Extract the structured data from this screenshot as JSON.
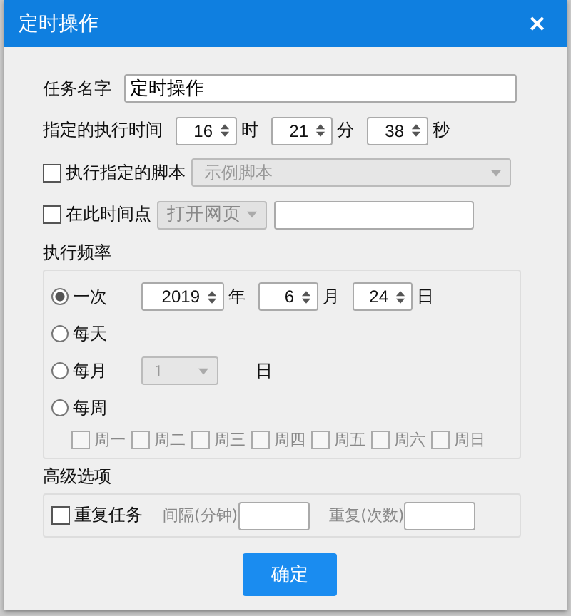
{
  "window": {
    "title": "定时操作",
    "close": "✕"
  },
  "task_name": {
    "label": "任务名字",
    "value": "定时操作"
  },
  "exec_time": {
    "label": "指定的执行时间",
    "fields": [
      {
        "value": "16",
        "unit": "时"
      },
      {
        "value": "21",
        "unit": "分"
      },
      {
        "value": "38",
        "unit": "秒"
      }
    ]
  },
  "script": {
    "label": "执行指定的脚本",
    "checked": false,
    "dropdown": {
      "value": "示例脚本",
      "disabled": true
    }
  },
  "time_point": {
    "label": "在此时间点",
    "checked": false,
    "action": {
      "label": "打开网页",
      "disabled": true
    }
  },
  "frequency": {
    "label": "执行频率",
    "options": [
      {
        "label": "一次",
        "selected": true
      },
      {
        "label": "每天",
        "selected": false
      },
      {
        "label": "每月",
        "selected": false
      },
      {
        "label": "每周",
        "selected": false
      }
    ],
    "date": [
      {
        "value": "2019",
        "unit": "年"
      },
      {
        "value": "6",
        "unit": "月"
      },
      {
        "value": "24",
        "unit": "日"
      }
    ],
    "month_day": {
      "value": "1",
      "disabled": true,
      "unit": "日"
    },
    "weekdays": [
      {
        "label": "周一",
        "checked": false,
        "disabled": true
      },
      {
        "label": "周二",
        "checked": false,
        "disabled": true
      },
      {
        "label": "周三",
        "checked": false,
        "disabled": true
      },
      {
        "label": "周四",
        "checked": false,
        "disabled": true
      },
      {
        "label": "周五",
        "checked": false,
        "disabled": true
      },
      {
        "label": "周六",
        "checked": false,
        "disabled": true
      },
      {
        "label": "周日",
        "checked": false,
        "disabled": true
      }
    ]
  },
  "advanced": {
    "label": "高级选项",
    "repeat": {
      "label": "重复任务",
      "checked": false
    },
    "interval": {
      "label": "间隔(分钟)",
      "disabled": true
    },
    "count": {
      "label": "重复(次数)",
      "disabled": true
    }
  },
  "buttons": [
    {
      "label": "确定"
    }
  ]
}
